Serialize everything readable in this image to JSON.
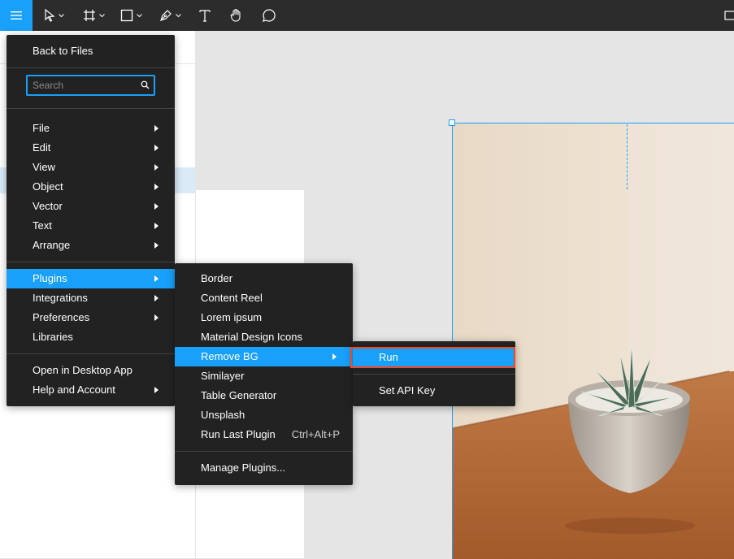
{
  "toolbar": {
    "tools": [
      {
        "name": "main-menu-icon"
      },
      {
        "name": "move-tool-icon"
      },
      {
        "name": "frame-tool-icon"
      },
      {
        "name": "shape-tool-icon"
      },
      {
        "name": "pen-tool-icon"
      },
      {
        "name": "text-tool-icon"
      },
      {
        "name": "hand-tool-icon"
      },
      {
        "name": "comment-tool-icon"
      }
    ],
    "accent": "#18a0fb"
  },
  "main_menu": {
    "back": "Back to Files",
    "search_placeholder": "Search",
    "items": [
      "File",
      "Edit",
      "View",
      "Object",
      "Vector",
      "Text",
      "Arrange"
    ],
    "items2": [
      "Plugins",
      "Integrations",
      "Preferences",
      "Libraries"
    ],
    "items3": [
      "Open in Desktop App",
      "Help and Account"
    ]
  },
  "plugins_menu": {
    "items": [
      "Border",
      "Content Reel",
      "Lorem ipsum",
      "Material Design Icons",
      "Remove BG",
      "Similayer",
      "Table Generator",
      "Unsplash",
      "Run Last Plugin"
    ],
    "run_last_shortcut": "Ctrl+Alt+P",
    "manage": "Manage Plugins..."
  },
  "removebg_menu": {
    "run": "Run",
    "set_api_key": "Set API Key"
  },
  "colors": {
    "highlight": "#f24822",
    "menu_bg": "#222222",
    "active": "#18a0fb"
  }
}
